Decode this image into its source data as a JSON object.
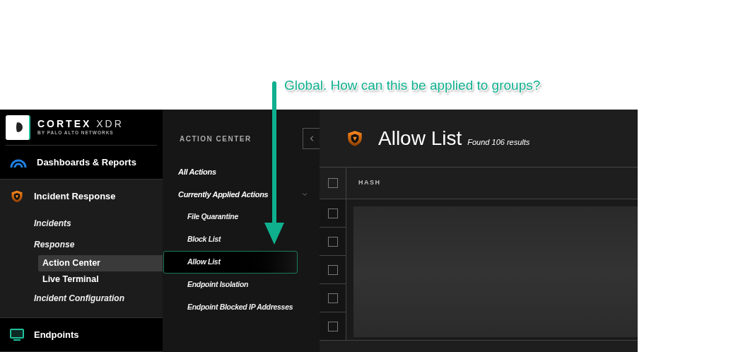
{
  "annotation": {
    "text": "Global. How can this be applied to groups?"
  },
  "brand": {
    "name": "CORTEX",
    "suffix": "XDR",
    "tagline": "BY PALO ALTO NETWORKS"
  },
  "nav": [
    {
      "label": "Dashboards & Reports",
      "expanded": false
    },
    {
      "label": "Incident Response",
      "expanded": true,
      "children": [
        {
          "label": "Incidents"
        },
        {
          "label": "Response",
          "children": [
            {
              "label": "Action Center",
              "selected": true
            },
            {
              "label": "Live Terminal",
              "selected": false
            }
          ]
        },
        {
          "label": "Incident Configuration"
        }
      ]
    },
    {
      "label": "Endpoints",
      "expanded": false
    }
  ],
  "panel": {
    "title": "ACTION CENTER",
    "items": [
      {
        "label": "All Actions"
      },
      {
        "label": "Currently Applied Actions",
        "expanded": true,
        "children": [
          {
            "label": "File Quarantine",
            "selected": false
          },
          {
            "label": "Block List",
            "selected": false
          },
          {
            "label": "Allow List",
            "selected": true
          },
          {
            "label": "Endpoint Isolation",
            "selected": false
          },
          {
            "label": "Endpoint Blocked IP Addresses",
            "selected": false
          }
        ]
      }
    ]
  },
  "main": {
    "title": "Allow List",
    "count": "Found 106 results",
    "header_checked": false,
    "columns": [
      "HASH"
    ],
    "rows": [
      {
        "checked": false
      },
      {
        "checked": false
      },
      {
        "checked": false
      },
      {
        "checked": false
      },
      {
        "checked": false
      }
    ]
  }
}
